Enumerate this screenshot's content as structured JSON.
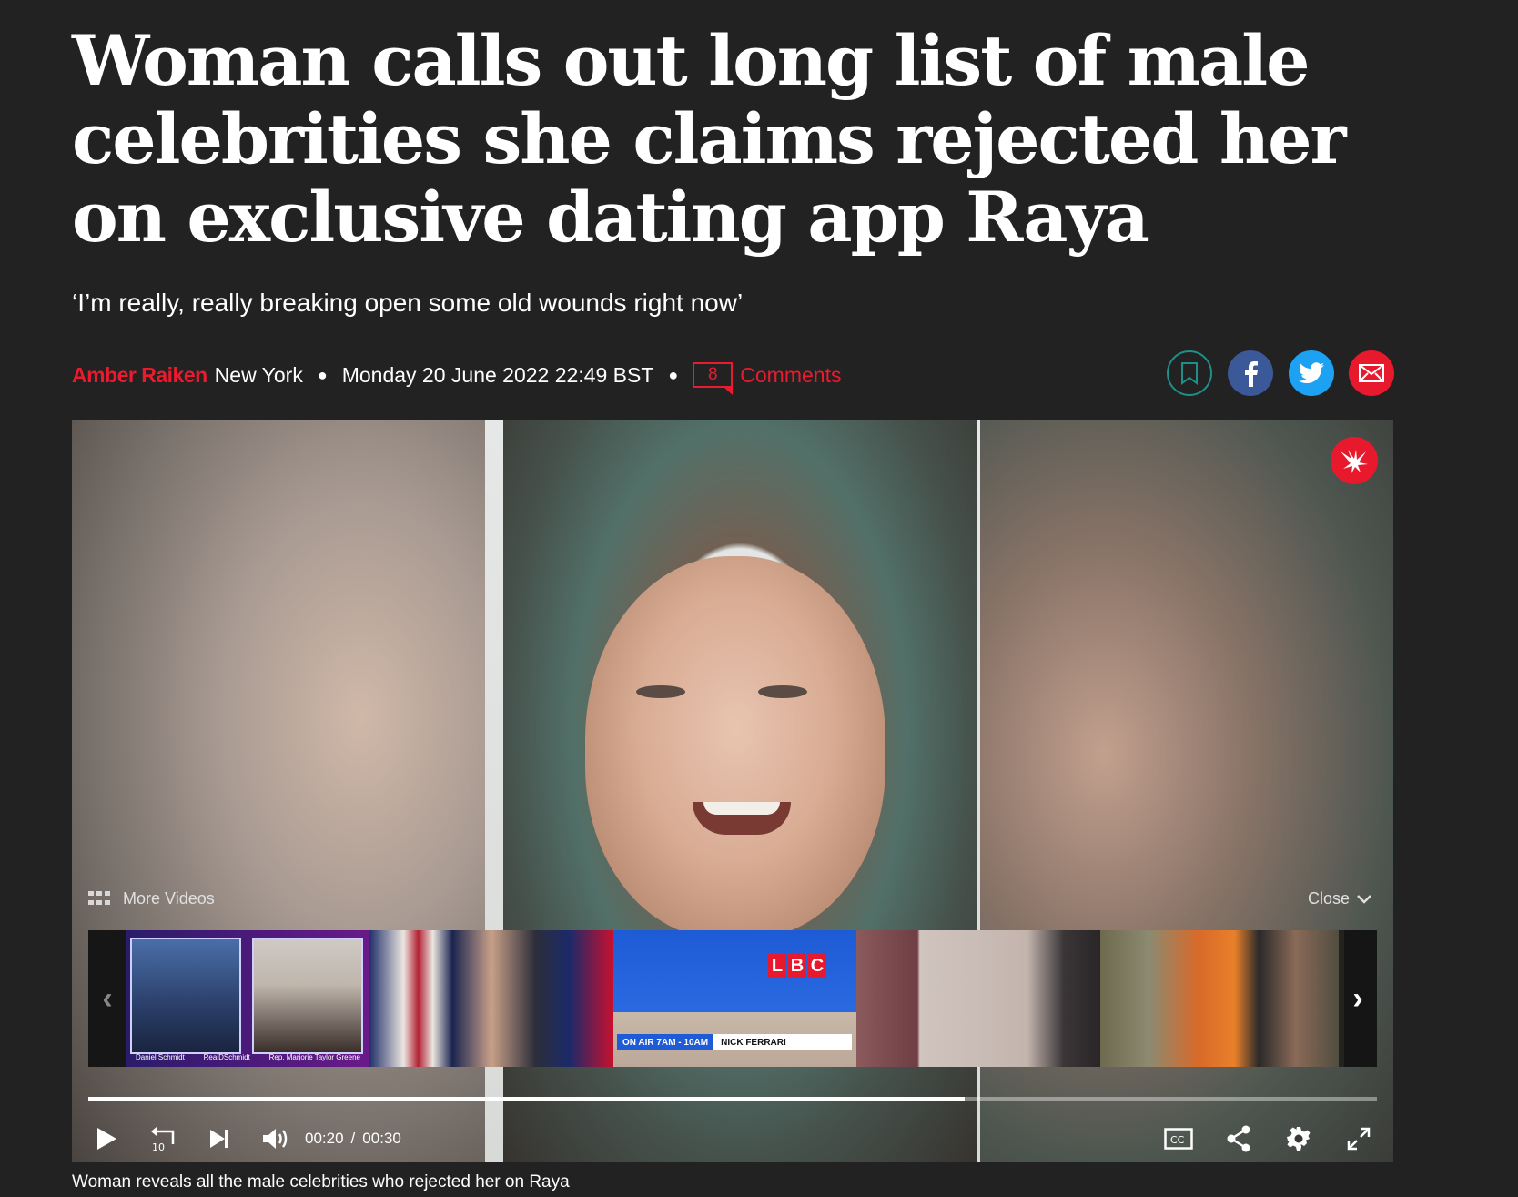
{
  "article": {
    "headline": "Woman calls out long list of male celebrities she claims rejected her on exclusive dating app Raya",
    "standfirst": "‘I’m really, really breaking open some old wounds right now’",
    "author": "Amber Raiken",
    "location": "New York",
    "date": "Monday 20 June 2022 22:49 BST",
    "comment_count": "8",
    "comments_label": "Comments"
  },
  "share": {
    "icons": [
      "bookmark-icon",
      "facebook-icon",
      "twitter-icon",
      "email-icon"
    ],
    "colors": {
      "bookmark": "#1f8f89",
      "facebook": "#3b5998",
      "twitter": "#1da1f2",
      "email": "#e8192c"
    }
  },
  "player": {
    "more_videos_label": "More Videos",
    "close_label": "Close",
    "progress_fraction": 0.68,
    "current_time": "00:20",
    "time_separator": "/",
    "duration": "00:30",
    "caption": "Woman reveals all the male celebrities who rejected her on Raya",
    "thumbnails": [
      {
        "caption_left": "Daniel Schmidt",
        "caption_mid": "RealDSchmidt",
        "caption_right": "Rep. Marjorie Taylor Greene"
      },
      {},
      {
        "logo": [
          "L",
          "B",
          "C"
        ],
        "bar_badge": "ON AIR 7AM - 10AM",
        "bar_text": "NICK FERRARI"
      },
      {},
      {}
    ]
  },
  "colors": {
    "background": "#222222",
    "accent": "#ec1a2e"
  }
}
